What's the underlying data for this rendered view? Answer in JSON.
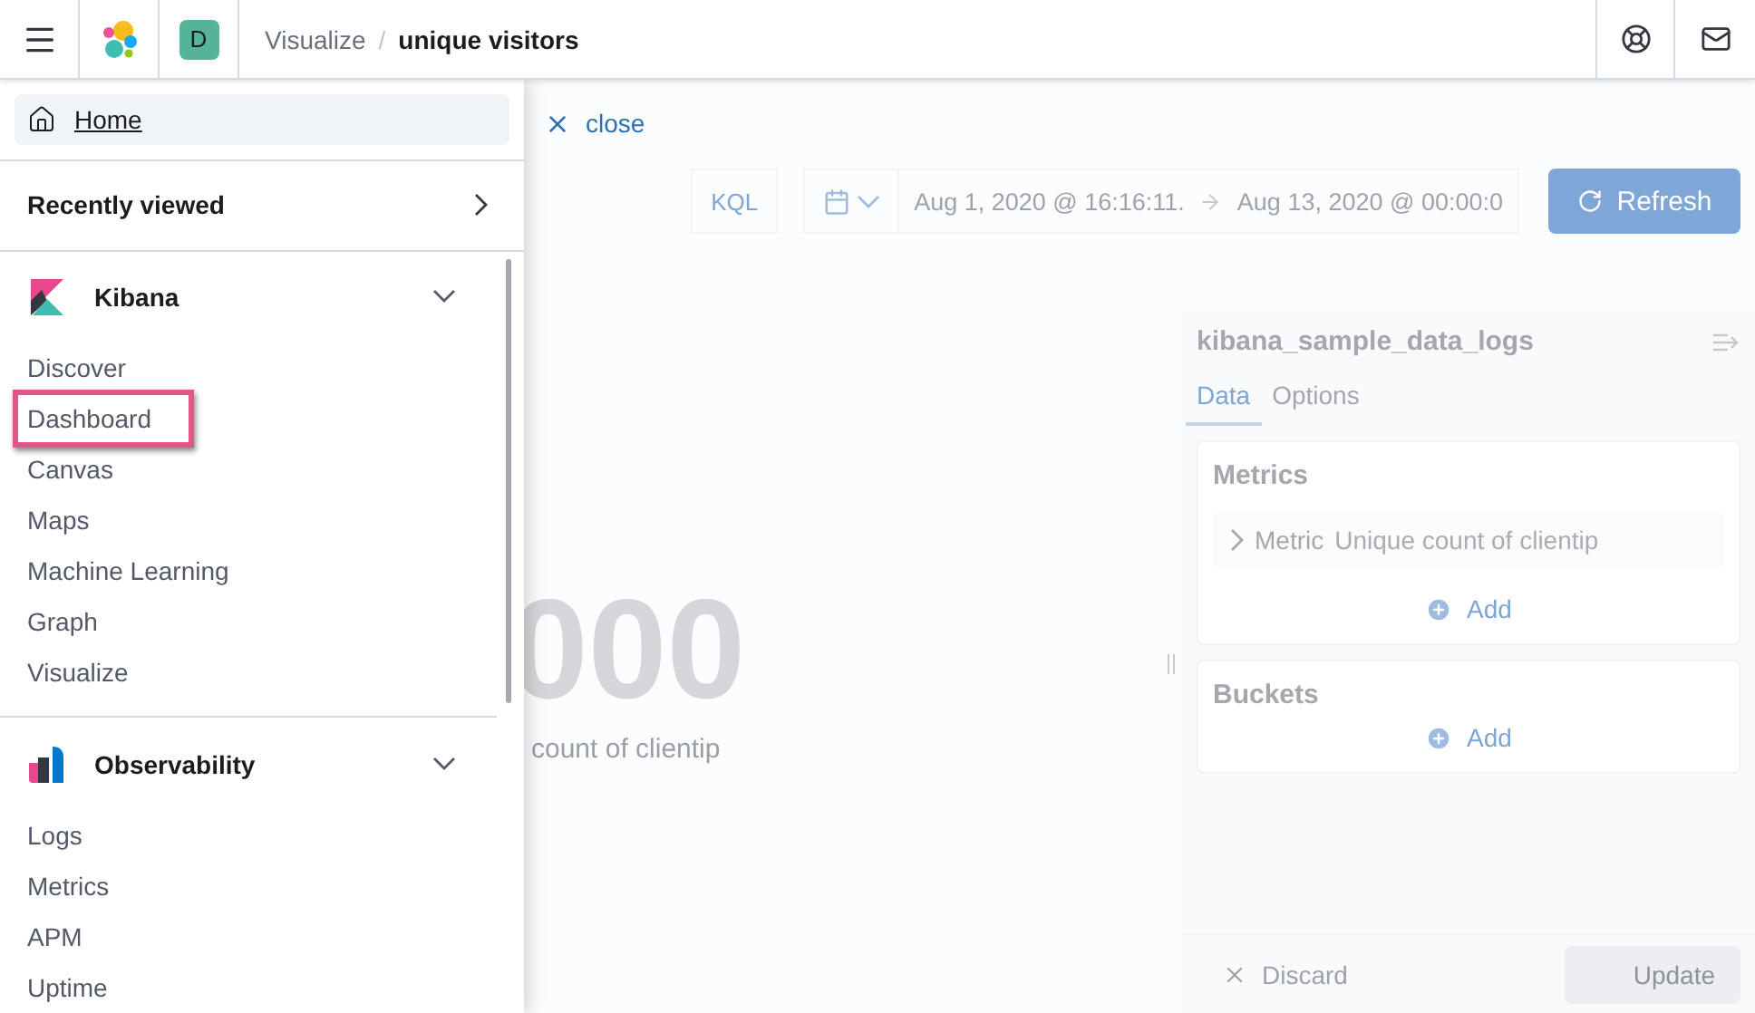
{
  "header": {
    "avatar": "D",
    "separator": "/",
    "breadcrumbs": [
      {
        "label": "Visualize",
        "current": false
      },
      {
        "label": "unique visitors",
        "current": true
      }
    ]
  },
  "nav": {
    "home": {
      "label": "Home",
      "selected": true
    },
    "recently_viewed": {
      "label": "Recently viewed",
      "expanded": false
    },
    "groups": [
      {
        "kind": "kibana",
        "title": "Kibana",
        "expanded": true,
        "items": [
          {
            "label": "Discover",
            "highlighted": false
          },
          {
            "label": "Dashboard",
            "highlighted": true
          },
          {
            "label": "Canvas",
            "highlighted": false
          },
          {
            "label": "Maps",
            "highlighted": false
          },
          {
            "label": "Machine Learning",
            "highlighted": false
          },
          {
            "label": "Graph",
            "highlighted": false
          },
          {
            "label": "Visualize",
            "highlighted": false
          }
        ]
      },
      {
        "kind": "observability",
        "title": "Observability",
        "expanded": true,
        "items": [
          {
            "label": "Logs",
            "highlighted": false
          },
          {
            "label": "Metrics",
            "highlighted": false
          },
          {
            "label": "APM",
            "highlighted": false
          },
          {
            "label": "Uptime",
            "highlighted": false
          }
        ]
      }
    ]
  },
  "page": {
    "close_link": "close",
    "query": {
      "language": "KQL",
      "start": "Aug 1, 2020 @ 16:16:11.",
      "end": "Aug 13, 2020 @ 00:00:0",
      "refresh": "Refresh"
    },
    "metric": {
      "value": "000",
      "label": "count of clientip"
    },
    "editor": {
      "title": "kibana_sample_data_logs",
      "tabs": [
        {
          "label": "Data",
          "selected": true
        },
        {
          "label": "Options",
          "selected": false
        }
      ],
      "sections": [
        {
          "title": "Metrics",
          "rows": [
            {
              "label": "Metric",
              "value": "Unique count of clientip"
            }
          ],
          "add": "Add"
        },
        {
          "title": "Buckets",
          "add": "Add"
        }
      ],
      "footer": {
        "discard": "Discard",
        "update": "Update"
      }
    }
  }
}
